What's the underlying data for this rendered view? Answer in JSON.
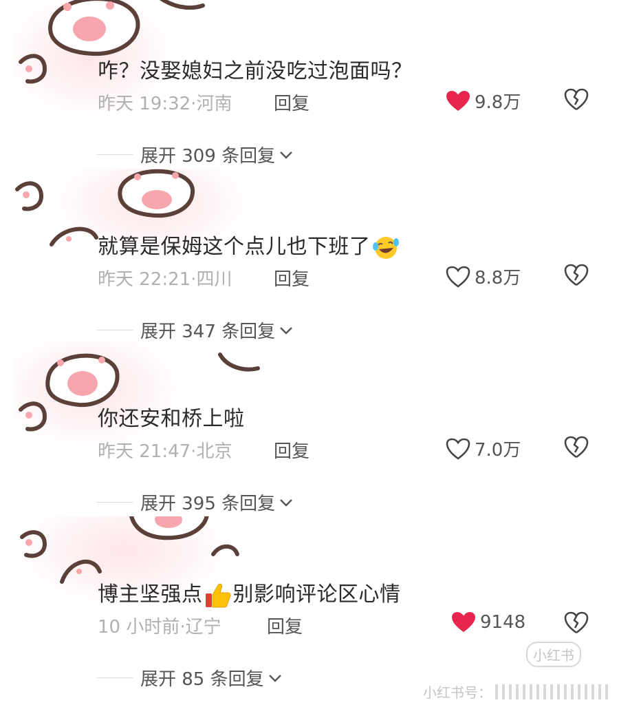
{
  "colors": {
    "liked_heart": "#e8254f",
    "icon_gray": "#444444",
    "meta_gray": "#b0b0b0",
    "paw_pink": "#f7a6ad",
    "paw_outline": "#5a4038"
  },
  "comments": [
    {
      "text": "咋？没娶媳妇之前没吃过泡面吗？",
      "time": "昨天 19:32",
      "location": "河南",
      "reply_label": "回复",
      "likes": "9.8万",
      "liked": true,
      "expand_label": "展开 309 条回复"
    },
    {
      "text": "就算是保姆这个点儿也下班了",
      "emoji": "rofl-emoji",
      "time": "昨天 22:21",
      "location": "四川",
      "reply_label": "回复",
      "likes": "8.8万",
      "liked": false,
      "expand_label": "展开 347 条回复"
    },
    {
      "text": "你还安和桥上啦",
      "time": "昨天 21:47",
      "location": "北京",
      "reply_label": "回复",
      "likes": "7.0万",
      "liked": false,
      "expand_label": "展开 395 条回复"
    },
    {
      "text_before": "博主坚强点",
      "emoji": "thumbs-up-emoji",
      "text_after": "别影响评论区心情",
      "time": "10 小时前",
      "location": "辽宁",
      "reply_label": "回复",
      "likes": "9148",
      "liked": true,
      "expand_label": "展开 85 条回复"
    }
  ],
  "watermark": {
    "text": "小红书号：",
    "badge": "小红书"
  }
}
